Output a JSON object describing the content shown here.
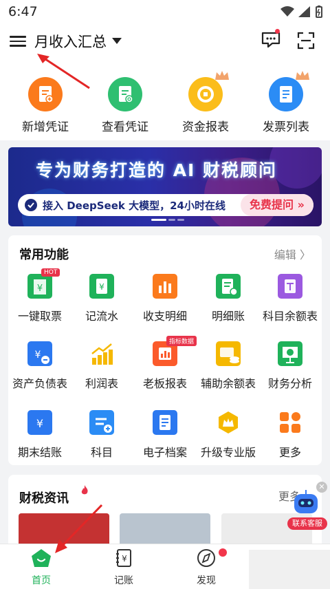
{
  "status_bar": {
    "time": "6:47"
  },
  "header": {
    "title": "月收入汇总"
  },
  "quick_actions": [
    {
      "label": "新增凭证",
      "color": "#fb7a1c"
    },
    {
      "label": "查看凭证",
      "color": "#2fbf71"
    },
    {
      "label": "资金报表",
      "color": "#fbbd1a"
    },
    {
      "label": "发票列表",
      "color": "#2b8cf5"
    }
  ],
  "banner": {
    "title": "专为财务打造的 AI 财税顾问",
    "subtitle": "接入 DeepSeek 大模型，24小时在线",
    "button": "免费提问 »"
  },
  "functions": {
    "title": "常用功能",
    "edit": "编辑 〉",
    "items": [
      {
        "label": "一键取票",
        "color": "#1fb25a",
        "tag": "HOT"
      },
      {
        "label": "记流水",
        "color": "#1fb25a"
      },
      {
        "label": "收支明细",
        "color": "#fb7a1c"
      },
      {
        "label": "明细账",
        "color": "#1fb25a"
      },
      {
        "label": "科目余额表",
        "color": "#9b59e0"
      },
      {
        "label": "资产负债表",
        "color": "#2b78f0"
      },
      {
        "label": "利润表",
        "color": "#f5b800"
      },
      {
        "label": "老板报表",
        "color": "#fb5a2b",
        "tag": "指标数据"
      },
      {
        "label": "辅助余额表",
        "color": "#f5b800"
      },
      {
        "label": "财务分析",
        "color": "#1fb25a"
      },
      {
        "label": "期末结账",
        "color": "#2b78f0"
      },
      {
        "label": "科目",
        "color": "#2b8cf5"
      },
      {
        "label": "电子档案",
        "color": "#2b78f0"
      },
      {
        "label": "升级专业版",
        "color": "#f5b800"
      },
      {
        "label": "更多",
        "color": "#fb7a1c"
      }
    ]
  },
  "news": {
    "title": "财税资讯",
    "more": "更多"
  },
  "service": {
    "label": "联系客服",
    "close": "✕"
  },
  "tabs": [
    {
      "label": "首页",
      "active": true
    },
    {
      "label": "记账",
      "active": false
    },
    {
      "label": "发现",
      "active": false
    }
  ]
}
